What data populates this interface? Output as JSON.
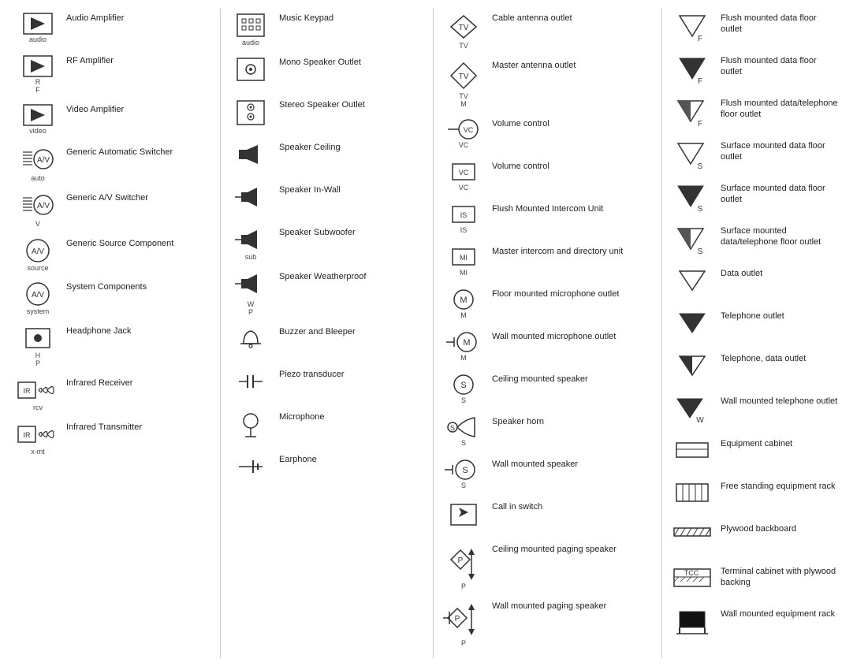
{
  "columns": [
    {
      "items": [
        {
          "id": "audio-amp",
          "label": "audio",
          "text": "Audio Amplifier",
          "icon": "audio-amp"
        },
        {
          "id": "rf-amp",
          "label": "R\nF",
          "text": "RF Amplifier",
          "icon": "rf-amp"
        },
        {
          "id": "video-amp",
          "label": "video",
          "text": "Video Amplifier",
          "icon": "video-amp"
        },
        {
          "id": "generic-auto-switcher",
          "label": "auto",
          "text": "Generic Automatic Switcher",
          "icon": "auto-switcher"
        },
        {
          "id": "generic-av-switcher",
          "label": "V",
          "text": "Generic A/V Switcher",
          "icon": "av-switcher"
        },
        {
          "id": "generic-source",
          "label": "source",
          "text": "Generic Source Component",
          "icon": "source"
        },
        {
          "id": "system-components",
          "label": "system",
          "text": "System Components",
          "icon": "system"
        },
        {
          "id": "headphone-jack",
          "label": "H\nP",
          "text": "Headphone Jack",
          "icon": "headphone-jack"
        },
        {
          "id": "infrared-receiver",
          "label": "rcv",
          "text": "Infrared Receiver",
          "icon": "ir-receiver"
        },
        {
          "id": "infrared-transmitter",
          "label": "x-mt",
          "text": "Infrared Transmitter",
          "icon": "ir-transmitter"
        }
      ]
    },
    {
      "items": [
        {
          "id": "music-keypad",
          "label": "audio",
          "text": "Music Keypad",
          "icon": "music-keypad"
        },
        {
          "id": "mono-speaker-outlet",
          "label": "",
          "text": "Mono Speaker Outlet",
          "icon": "mono-speaker"
        },
        {
          "id": "stereo-speaker-outlet",
          "label": "",
          "text": "Stereo Speaker Outlet",
          "icon": "stereo-speaker"
        },
        {
          "id": "speaker-ceiling",
          "label": "",
          "text": "Speaker Ceiling",
          "icon": "speaker-ceiling"
        },
        {
          "id": "speaker-inwall",
          "label": "",
          "text": "Speaker In-Wall",
          "icon": "speaker-inwall"
        },
        {
          "id": "speaker-subwoofer",
          "label": "sub",
          "text": "Speaker Subwoofer",
          "icon": "speaker-subwoofer"
        },
        {
          "id": "speaker-weatherproof",
          "label": "W\nP",
          "text": "Speaker Weatherproof",
          "icon": "speaker-weatherproof"
        },
        {
          "id": "buzzer-bleeper",
          "label": "",
          "text": "Buzzer and Bleeper",
          "icon": "buzzer"
        },
        {
          "id": "piezo-transducer",
          "label": "",
          "text": "Piezo transducer",
          "icon": "piezo"
        },
        {
          "id": "microphone",
          "label": "",
          "text": "Microphone",
          "icon": "microphone"
        },
        {
          "id": "earphone",
          "label": "",
          "text": "Earphone",
          "icon": "earphone"
        }
      ]
    },
    {
      "items": [
        {
          "id": "cable-antenna",
          "label": "TV",
          "text": "Cable antenna outlet",
          "icon": "cable-antenna"
        },
        {
          "id": "master-antenna",
          "label": "TV\nM",
          "text": "Master antenna outlet",
          "icon": "master-antenna"
        },
        {
          "id": "volume-control-1",
          "label": "VC",
          "text": "Volume control",
          "icon": "volume-control-line"
        },
        {
          "id": "volume-control-2",
          "label": "VC",
          "text": "Volume control",
          "icon": "volume-control-box"
        },
        {
          "id": "flush-intercom",
          "label": "IS",
          "text": "Flush Mounted Intercom Unit",
          "icon": "flush-intercom"
        },
        {
          "id": "master-intercom",
          "label": "MI",
          "text": "Master intercom and directory unit",
          "icon": "master-intercom"
        },
        {
          "id": "floor-mic-outlet",
          "label": "M",
          "text": "Floor mounted microphone outlet",
          "icon": "floor-mic"
        },
        {
          "id": "wall-mic-outlet",
          "label": "M",
          "text": "Wall mounted microphone outlet",
          "icon": "wall-mic"
        },
        {
          "id": "ceiling-speaker",
          "label": "S",
          "text": "Ceiling mounted speaker",
          "icon": "ceiling-speaker"
        },
        {
          "id": "speaker-horn",
          "label": "S",
          "text": "Speaker horn",
          "icon": "speaker-horn"
        },
        {
          "id": "wall-speaker",
          "label": "S",
          "text": "Wall mounted speaker",
          "icon": "wall-speaker"
        },
        {
          "id": "call-in-switch",
          "label": "",
          "text": "Call in switch",
          "icon": "call-in-switch"
        },
        {
          "id": "ceiling-paging",
          "label": "P",
          "text": "Ceiling mounted paging speaker",
          "icon": "ceiling-paging"
        },
        {
          "id": "wall-paging",
          "label": "P",
          "text": "Wall mounted paging speaker",
          "icon": "wall-paging"
        }
      ]
    },
    {
      "items": [
        {
          "id": "flush-data-floor-1",
          "label": "F",
          "text": "Flush mounted data floor outlet",
          "icon": "flush-data-outline"
        },
        {
          "id": "flush-data-floor-2",
          "label": "F",
          "text": "Flush mounted data floor outlet",
          "icon": "flush-data-filled"
        },
        {
          "id": "flush-data-phone-floor",
          "label": "F",
          "text": "Flush mounted data/telephone floor outlet",
          "icon": "flush-data-phone"
        },
        {
          "id": "surface-data-floor-1",
          "label": "S",
          "text": "Surface mounted data floor outlet",
          "icon": "surface-data-outline"
        },
        {
          "id": "surface-data-floor-2",
          "label": "S",
          "text": "Surface mounted data floor outlet",
          "icon": "surface-data-filled"
        },
        {
          "id": "surface-data-phone-floor",
          "label": "S",
          "text": "Surface mounted data/telephone floor outlet",
          "icon": "surface-data-phone"
        },
        {
          "id": "data-outlet",
          "label": "",
          "text": "Data outlet",
          "icon": "data-outlet"
        },
        {
          "id": "telephone-outlet",
          "label": "",
          "text": "Telephone outlet",
          "icon": "telephone-outlet"
        },
        {
          "id": "telephone-data-outlet",
          "label": "",
          "text": "Telephone, data outlet",
          "icon": "telephone-data-outlet"
        },
        {
          "id": "wall-telephone-outlet",
          "label": "W",
          "text": "Wall mounted telephone outlet",
          "icon": "wall-telephone-outlet"
        },
        {
          "id": "equipment-cabinet",
          "label": "",
          "text": "Equipment cabinet",
          "icon": "equipment-cabinet"
        },
        {
          "id": "free-standing-rack",
          "label": "",
          "text": "Free standing equipment rack",
          "icon": "free-standing-rack"
        },
        {
          "id": "plywood-backboard",
          "label": "",
          "text": "Plywood backboard",
          "icon": "plywood-backboard"
        },
        {
          "id": "terminal-cabinet",
          "label": "TCC",
          "text": "Terminal cabinet with plywood backing",
          "icon": "terminal-cabinet"
        },
        {
          "id": "wall-equipment-rack",
          "label": "",
          "text": "Wall mounted equipment rack",
          "icon": "wall-equipment-rack"
        }
      ]
    }
  ]
}
